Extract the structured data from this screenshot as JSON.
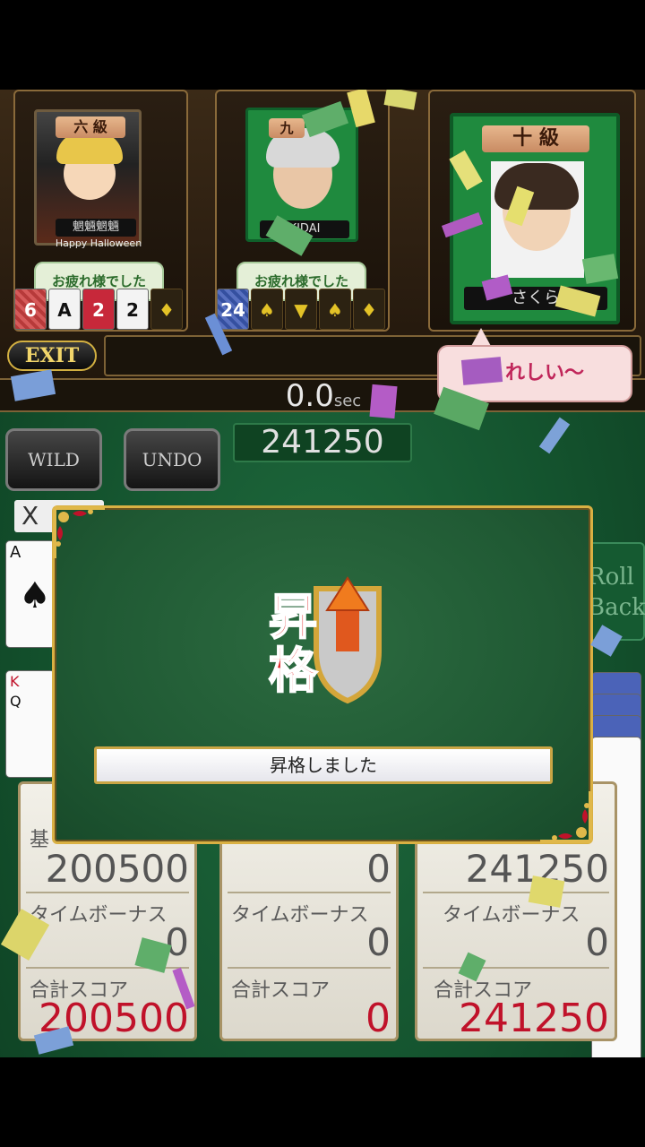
{
  "players": [
    {
      "rank": "六 級",
      "name": "魍魎魍魎",
      "subtitle": "Happy Halloween",
      "bubble": "お疲れ様でした",
      "hand": [
        "6",
        "A",
        "2",
        "2",
        "♦"
      ]
    },
    {
      "rank": "九",
      "name": "KIDAI",
      "bubble": "お疲れ様でした",
      "hand": [
        "24",
        "♠",
        "▼",
        "♠",
        "♦"
      ]
    },
    {
      "rank": "十 級",
      "name": "さくら",
      "bubble": "うれしい〜"
    }
  ],
  "exit_label": "EXIT",
  "timer": {
    "main": "0.0",
    "unit": "sec"
  },
  "current_score": "241250",
  "buttons": {
    "wild": "WILD",
    "undo": "UNDO",
    "roll_back": "Roll Back"
  },
  "x_count": "X",
  "cards": {
    "ace": "A",
    "king": "K",
    "queen": "Q"
  },
  "score_boxes": [
    {
      "base_label": "基",
      "base": "200500",
      "time_label": "タイムボーナス",
      "time": "0",
      "total_label": "合計スコア",
      "total": "200500"
    },
    {
      "base": "0",
      "time_label": "タイムボーナス",
      "time": "0",
      "total_label": "合計スコア",
      "total": "0"
    },
    {
      "base": "241250",
      "time_label": "タイムボーナス",
      "time": "0",
      "total_label": "合計スコア",
      "total": "241250"
    }
  ],
  "modal": {
    "emblem_text": "昇格",
    "message": "昇格しました"
  },
  "colors": {
    "felt": "#1f6b3e",
    "gold": "#d9b043",
    "red_total": "#c0122a"
  }
}
